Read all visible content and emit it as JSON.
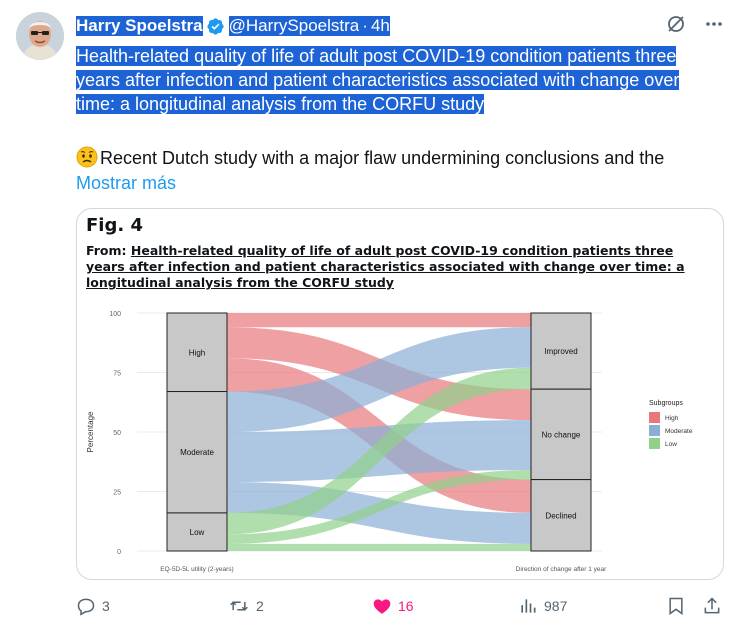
{
  "tweet": {
    "author_name": "Harry Spoelstra",
    "handle": "@HarrySpoelstra",
    "separator": "·",
    "time": "4h",
    "title": "Health-related quality of life of adult post COVID-19 condition patients three years after infection and patient characteristics associated with change over time: a longitudinal analysis from the CORFU study",
    "body": "Recent Dutch study with a major flaw undermining conclusions and the",
    "show_more": "Mostrar más"
  },
  "figure": {
    "label": "Fig. 4",
    "from_prefix": "From:",
    "from_title": "Health-related quality of life of adult post COVID-19 condition patients three years after infection and patient characteristics associated with change over time: a longitudinal analysis from the CORFU study"
  },
  "chart_data": {
    "type": "alluvial",
    "ylabel": "Percentage",
    "yticks": [
      "100",
      "75",
      "50",
      "25",
      "0"
    ],
    "ylim": [
      0,
      100
    ],
    "x_left_label": "EQ-5D-5L utility (2-years)",
    "x_right_label": "Direction of change after 1 year",
    "left_strata": [
      {
        "name": "High",
        "value": 33
      },
      {
        "name": "Moderate",
        "value": 51
      },
      {
        "name": "Low",
        "value": 16
      }
    ],
    "right_strata": [
      {
        "name": "Improved",
        "value": 32
      },
      {
        "name": "No change",
        "value": 38
      },
      {
        "name": "Declined",
        "value": 30
      }
    ],
    "legend_title": "Subgroups",
    "legend_placement": "right",
    "legend": [
      {
        "name": "High",
        "color": "#e8787c"
      },
      {
        "name": "Moderate",
        "color": "#8aafd6"
      },
      {
        "name": "Low",
        "color": "#90d08a"
      }
    ],
    "flows": [
      {
        "from": "High",
        "to": "Improved",
        "value": 6
      },
      {
        "from": "High",
        "to": "No change",
        "value": 13
      },
      {
        "from": "High",
        "to": "Declined",
        "value": 14
      },
      {
        "from": "Moderate",
        "to": "Improved",
        "value": 17
      },
      {
        "from": "Moderate",
        "to": "No change",
        "value": 21
      },
      {
        "from": "Moderate",
        "to": "Declined",
        "value": 13
      },
      {
        "from": "Low",
        "to": "Improved",
        "value": 9
      },
      {
        "from": "Low",
        "to": "No change",
        "value": 4
      },
      {
        "from": "Low",
        "to": "Declined",
        "value": 3
      }
    ]
  },
  "actions": {
    "replies": "3",
    "retweets": "2",
    "likes": "16",
    "views": "987"
  },
  "colors": {
    "link": "#1d9bf0",
    "like": "#f91880",
    "verified": "#1d9bf0",
    "selection": "#1d63d6"
  },
  "icons": [
    "verified-badge-icon",
    "grok-icon",
    "more-icon",
    "reply-icon",
    "retweet-icon",
    "like-icon",
    "views-icon",
    "bookmark-icon",
    "share-icon",
    "worried-face-emoji"
  ]
}
